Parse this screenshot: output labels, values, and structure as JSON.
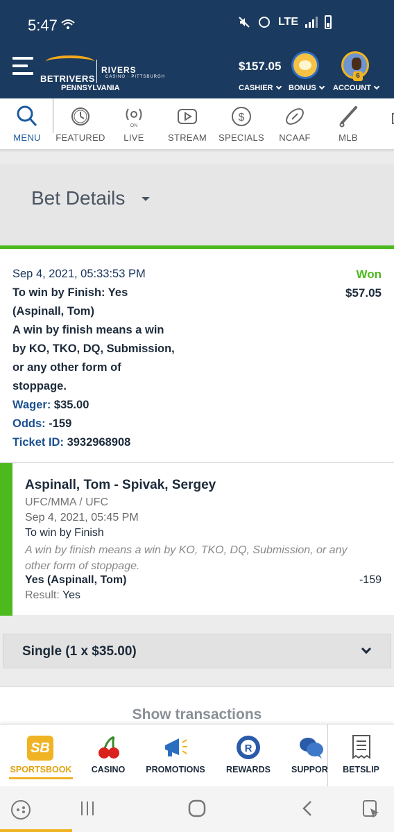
{
  "status_bar": {
    "time": "5:47",
    "network": "LTE"
  },
  "header": {
    "brand": "BETRIVERS",
    "partner": "RIVERS",
    "partner_sub": "CASINO · PITTSBURGH",
    "state": "PENNSYLVANIA",
    "balance": "$157.05",
    "cashier_label": "CASHIER",
    "bonus_label": "BONUS",
    "account_label": "ACCOUNT",
    "account_level": "6"
  },
  "categories": [
    {
      "label": "MENU",
      "icon": "search-icon"
    },
    {
      "label": "FEATURED",
      "icon": "clock-icon"
    },
    {
      "label": "LIVE",
      "icon": "live-on-icon"
    },
    {
      "label": "STREAM",
      "icon": "play-icon"
    },
    {
      "label": "SPECIALS",
      "icon": "dollar-icon"
    },
    {
      "label": "NCAAF",
      "icon": "football-icon"
    },
    {
      "label": "MLB",
      "icon": "baseball-bat-icon"
    }
  ],
  "bet_details": {
    "title": "Bet Details"
  },
  "bet_summary": {
    "placed_at": "Sep 4, 2021, 05:33:53 PM",
    "line1": "To win by Finish: Yes",
    "line2": "(Aspinall, Tom)",
    "desc1": "A win by finish means a win",
    "desc2": "by KO, TKO, DQ, Submission,",
    "desc3": "or any other form of",
    "desc4": "stoppage.",
    "wager_label": "Wager:",
    "wager_value": "$35.00",
    "odds_label": "Odds:",
    "odds_value": "-159",
    "ticket_label": "Ticket ID:",
    "ticket_value": "3932968908",
    "status": "Won",
    "payout": "$57.05",
    "status_color": "#4cb91d"
  },
  "selection": {
    "event": "Aspinall, Tom - Spivak, Sergey",
    "league": "UFC/MMA / UFC",
    "event_date": "Sep 4, 2021, 05:45 PM",
    "market": "To win by Finish",
    "market_desc": "A win by finish means a win by KO, TKO, DQ, Submission, or any other form of stoppage.",
    "choice": "Yes (Aspinall, Tom)",
    "odds": "-159",
    "result_label": "Result:",
    "result_value": "Yes"
  },
  "single": {
    "label": "Single (1 x $35.00)"
  },
  "transactions": {
    "label": "Show transactions"
  },
  "bottom_nav": [
    {
      "label": "SPORTSBOOK",
      "icon": "sportsbook-icon",
      "badge": "SB"
    },
    {
      "label": "CASINO",
      "icon": "cherries-icon"
    },
    {
      "label": "PROMOTIONS",
      "icon": "megaphone-icon"
    },
    {
      "label": "REWARDS",
      "icon": "rewards-icon"
    },
    {
      "label": "SUPPOR",
      "icon": "chat-icon"
    },
    {
      "label": "BETSLIP",
      "icon": "betslip-icon"
    }
  ]
}
